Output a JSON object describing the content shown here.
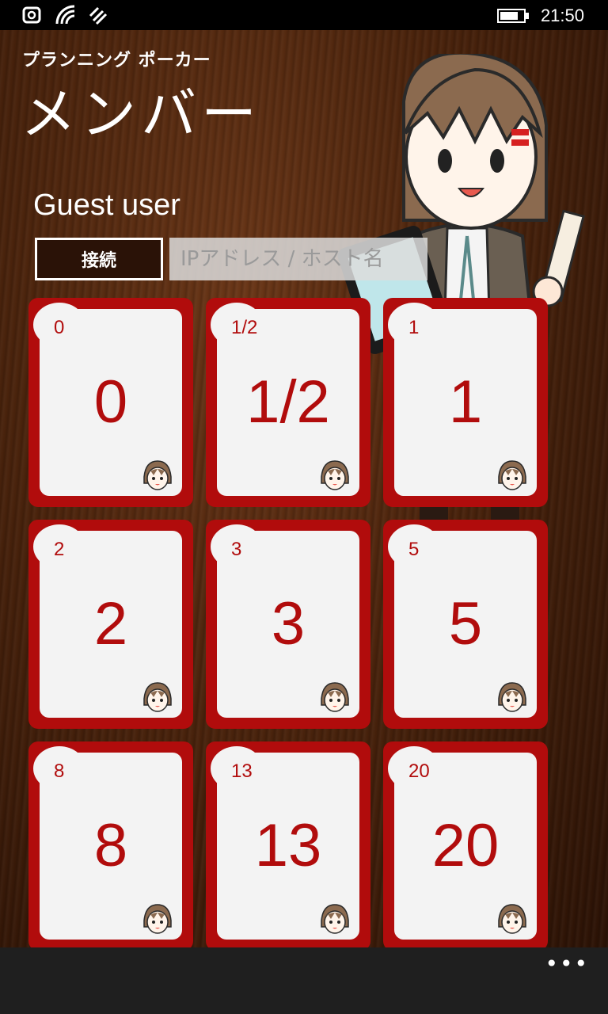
{
  "status_bar": {
    "time": "21:50",
    "icons": [
      "nfc-icon",
      "wifi-icon",
      "data-sync-icon",
      "battery-icon"
    ]
  },
  "header": {
    "app_title": "プランニング ポーカー",
    "page_title": "メンバー"
  },
  "user": {
    "name": "Guest user"
  },
  "connection": {
    "connect_label": "接続",
    "address_placeholder": "IPアドレス / ホスト名",
    "address_value": ""
  },
  "cards": [
    {
      "corner": "0",
      "value": "0"
    },
    {
      "corner": "1/2",
      "value": "1/2"
    },
    {
      "corner": "1",
      "value": "1"
    },
    {
      "corner": "2",
      "value": "2"
    },
    {
      "corner": "3",
      "value": "3"
    },
    {
      "corner": "5",
      "value": "5"
    },
    {
      "corner": "8",
      "value": "8"
    },
    {
      "corner": "13",
      "value": "13"
    },
    {
      "corner": "20",
      "value": "20"
    }
  ],
  "app_bar": {
    "more_label": "•••"
  },
  "colors": {
    "card_red": "#b10c0c",
    "card_face": "#f3f3f3",
    "background_wood": "#4a230c"
  }
}
